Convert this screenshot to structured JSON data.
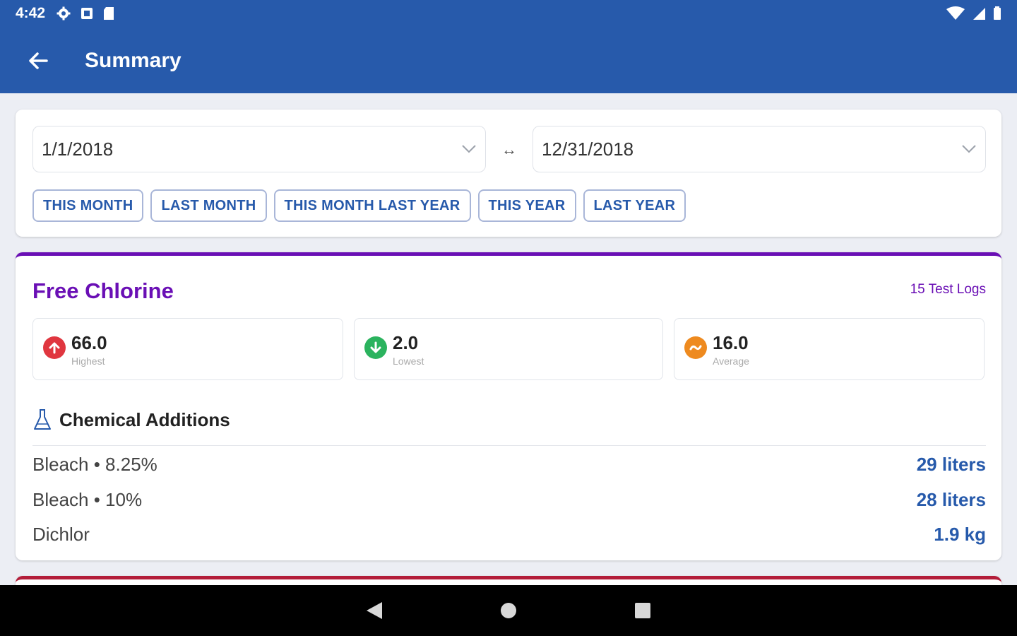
{
  "status_bar": {
    "time": "4:42",
    "icons": [
      "gear-icon",
      "notification-icon",
      "sd-card-icon"
    ],
    "right_icons": [
      "wifi-icon",
      "signal-icon",
      "battery-icon"
    ]
  },
  "toolbar": {
    "title": "Summary",
    "back_icon": "arrow-back-icon"
  },
  "date_range": {
    "start": "1/1/2018",
    "end": "12/31/2018",
    "separator": "↔",
    "presets": [
      "THIS MONTH",
      "LAST MONTH",
      "THIS MONTH LAST YEAR",
      "THIS YEAR",
      "LAST YEAR"
    ]
  },
  "chlorine": {
    "title": "Free Chlorine",
    "test_logs": "15 Test Logs",
    "accent": "#6a0fb5",
    "stats": [
      {
        "value": "66.0",
        "label": "Highest",
        "icon": "arrow-up-icon",
        "color": "#e0363f"
      },
      {
        "value": "2.0",
        "label": "Lowest",
        "icon": "arrow-down-icon",
        "color": "#2bb35e"
      },
      {
        "value": "16.0",
        "label": "Average",
        "icon": "tilde-icon",
        "color": "#ee8a1f"
      }
    ],
    "chemicals_title": "Chemical Additions",
    "chemicals": [
      {
        "name": "Bleach • 8.25%",
        "amount": "29 liters"
      },
      {
        "name": "Bleach • 10%",
        "amount": "28 liters"
      },
      {
        "name": "Dichlor",
        "amount": "1.9 kg"
      }
    ]
  },
  "colors": {
    "primary": "#275aab",
    "next_card_accent": "#b31d3a"
  }
}
